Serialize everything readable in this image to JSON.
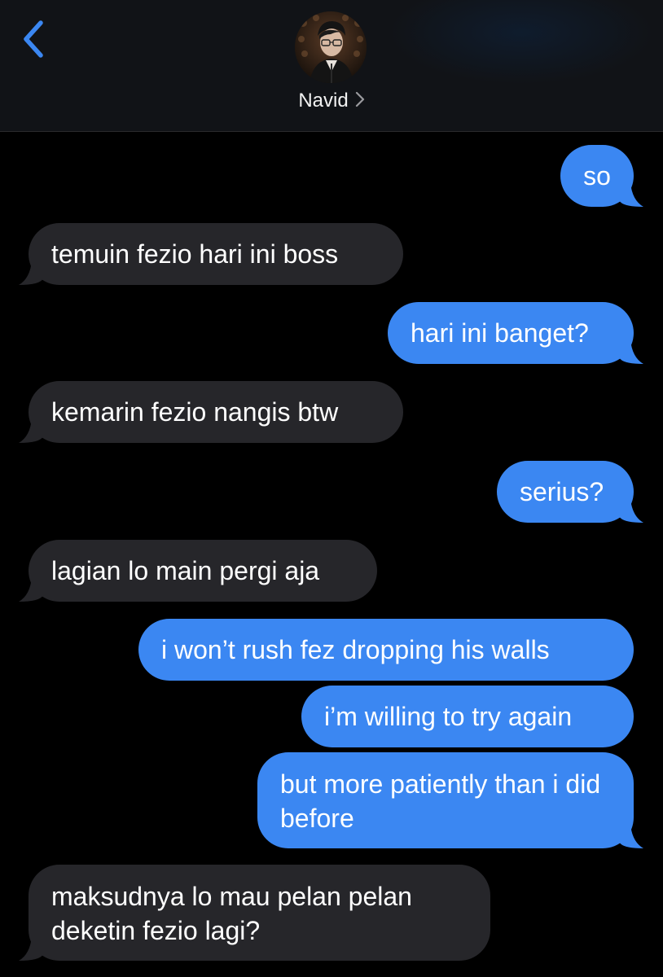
{
  "header": {
    "contact_name": "Navid",
    "back_icon": "chevron-left-icon",
    "name_chevron_icon": "chevron-right-icon",
    "accent_color": "#3b87f2"
  },
  "messages": [
    {
      "direction": "sent",
      "text": "so"
    },
    {
      "direction": "received",
      "text": "temuin fezio hari ini boss"
    },
    {
      "direction": "sent",
      "text": "hari ini banget?"
    },
    {
      "direction": "received",
      "text": "kemarin fezio nangis btw"
    },
    {
      "direction": "sent",
      "text": "serius?"
    },
    {
      "direction": "received",
      "text": "lagian lo main pergi aja"
    },
    {
      "direction": "sent",
      "text": "i won’t rush fez dropping his walls"
    },
    {
      "direction": "sent",
      "text": "i’m willing to try again"
    },
    {
      "direction": "sent",
      "text": "but more patiently than i did before"
    },
    {
      "direction": "received",
      "text": "maksudnya lo mau pelan pelan deketin fezio lagi?"
    }
  ],
  "colors": {
    "sent_bubble": "#3b87f2",
    "received_bubble": "#26262a",
    "background": "#000000"
  }
}
